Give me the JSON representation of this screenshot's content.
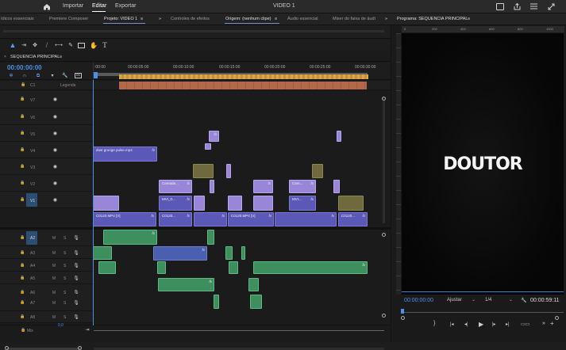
{
  "topbar": {
    "home_icon": "home-icon",
    "import_label": "Importar",
    "edit_label": "Editar",
    "export_label": "Exportar",
    "window_title": "VIDEO 1"
  },
  "tabs": {
    "items": [
      "ídicos essenciais",
      "Premiere Composer",
      "Projeto: VIDEO 1",
      "Controles de efeitos",
      "Origem: (nenhum clipe)",
      "Áudio essencial",
      "Mixer do faixa de áudi"
    ],
    "project_menu": "≡",
    "source_menu": "≡",
    "program_label": "Programa: SEQUENCIA PRINCIPAL",
    "program_menu": "≡",
    "more": "»"
  },
  "timeline": {
    "sequence_name": "SEQUENCIA PRINCIPAL",
    "menu": "≡",
    "timecode": "00:00:00:00",
    "ruler": [
      ":00:00",
      "00:00:05:00",
      "00:00:10:00",
      "00:00:15:00",
      "00:00:20:00",
      "00:00:25:00",
      "00:00:30:00"
    ],
    "legend_label": "Legenda",
    "c1_label": "C1",
    "video_tracks": [
      "V7",
      "V6",
      "V5",
      "V4",
      "V3",
      "V2",
      "V1"
    ],
    "audio_tracks": [
      "A2",
      "A3",
      "A4",
      "A5",
      "A6",
      "A7",
      "A8"
    ],
    "mix_label": "Mix",
    "mix_value": "0,0",
    "track_btn_m": "M",
    "track_btn_s": "S",
    "clips": {
      "v5_clip": "dust grunge pulse.mp4",
      "v3_clip1": "Camada...",
      "v3_clip2": "Cam...",
      "v2_clip1": "MVI_0...",
      "v2_clip2": "MVI...",
      "v1_clip1": "C0120.MP4 [V]",
      "v1_clip2": "C0120.MP4 [V]",
      "v1_clip3": "C0120...",
      "v1_clip4": "C0120...",
      "fx": "fx"
    }
  },
  "program": {
    "overlay_text": "DOUTOR",
    "timecode_in": "00:00:00:00",
    "fit_label": "Ajustar",
    "quality_label": "1/4",
    "timecode_out": "00:00:59:11",
    "ruler_marks": [
      "0",
      "200",
      "400",
      "600",
      "800",
      "1000"
    ]
  },
  "colors": {
    "accent": "#4a90e6",
    "video_clip": "#5b58b8",
    "video_clip_light": "#9a86d8",
    "audio_clip": "#3d8f5e"
  }
}
